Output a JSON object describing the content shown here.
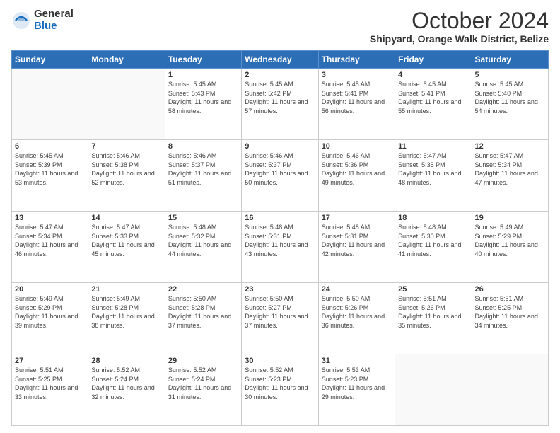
{
  "logo": {
    "general": "General",
    "blue": "Blue"
  },
  "title": "October 2024",
  "location": "Shipyard, Orange Walk District, Belize",
  "days_header": [
    "Sunday",
    "Monday",
    "Tuesday",
    "Wednesday",
    "Thursday",
    "Friday",
    "Saturday"
  ],
  "weeks": [
    [
      {
        "day": "",
        "sunrise": "",
        "sunset": "",
        "daylight": ""
      },
      {
        "day": "",
        "sunrise": "",
        "sunset": "",
        "daylight": ""
      },
      {
        "day": "1",
        "sunrise": "Sunrise: 5:45 AM",
        "sunset": "Sunset: 5:43 PM",
        "daylight": "Daylight: 11 hours and 58 minutes."
      },
      {
        "day": "2",
        "sunrise": "Sunrise: 5:45 AM",
        "sunset": "Sunset: 5:42 PM",
        "daylight": "Daylight: 11 hours and 57 minutes."
      },
      {
        "day": "3",
        "sunrise": "Sunrise: 5:45 AM",
        "sunset": "Sunset: 5:41 PM",
        "daylight": "Daylight: 11 hours and 56 minutes."
      },
      {
        "day": "4",
        "sunrise": "Sunrise: 5:45 AM",
        "sunset": "Sunset: 5:41 PM",
        "daylight": "Daylight: 11 hours and 55 minutes."
      },
      {
        "day": "5",
        "sunrise": "Sunrise: 5:45 AM",
        "sunset": "Sunset: 5:40 PM",
        "daylight": "Daylight: 11 hours and 54 minutes."
      }
    ],
    [
      {
        "day": "6",
        "sunrise": "Sunrise: 5:45 AM",
        "sunset": "Sunset: 5:39 PM",
        "daylight": "Daylight: 11 hours and 53 minutes."
      },
      {
        "day": "7",
        "sunrise": "Sunrise: 5:46 AM",
        "sunset": "Sunset: 5:38 PM",
        "daylight": "Daylight: 11 hours and 52 minutes."
      },
      {
        "day": "8",
        "sunrise": "Sunrise: 5:46 AM",
        "sunset": "Sunset: 5:37 PM",
        "daylight": "Daylight: 11 hours and 51 minutes."
      },
      {
        "day": "9",
        "sunrise": "Sunrise: 5:46 AM",
        "sunset": "Sunset: 5:37 PM",
        "daylight": "Daylight: 11 hours and 50 minutes."
      },
      {
        "day": "10",
        "sunrise": "Sunrise: 5:46 AM",
        "sunset": "Sunset: 5:36 PM",
        "daylight": "Daylight: 11 hours and 49 minutes."
      },
      {
        "day": "11",
        "sunrise": "Sunrise: 5:47 AM",
        "sunset": "Sunset: 5:35 PM",
        "daylight": "Daylight: 11 hours and 48 minutes."
      },
      {
        "day": "12",
        "sunrise": "Sunrise: 5:47 AM",
        "sunset": "Sunset: 5:34 PM",
        "daylight": "Daylight: 11 hours and 47 minutes."
      }
    ],
    [
      {
        "day": "13",
        "sunrise": "Sunrise: 5:47 AM",
        "sunset": "Sunset: 5:34 PM",
        "daylight": "Daylight: 11 hours and 46 minutes."
      },
      {
        "day": "14",
        "sunrise": "Sunrise: 5:47 AM",
        "sunset": "Sunset: 5:33 PM",
        "daylight": "Daylight: 11 hours and 45 minutes."
      },
      {
        "day": "15",
        "sunrise": "Sunrise: 5:48 AM",
        "sunset": "Sunset: 5:32 PM",
        "daylight": "Daylight: 11 hours and 44 minutes."
      },
      {
        "day": "16",
        "sunrise": "Sunrise: 5:48 AM",
        "sunset": "Sunset: 5:31 PM",
        "daylight": "Daylight: 11 hours and 43 minutes."
      },
      {
        "day": "17",
        "sunrise": "Sunrise: 5:48 AM",
        "sunset": "Sunset: 5:31 PM",
        "daylight": "Daylight: 11 hours and 42 minutes."
      },
      {
        "day": "18",
        "sunrise": "Sunrise: 5:48 AM",
        "sunset": "Sunset: 5:30 PM",
        "daylight": "Daylight: 11 hours and 41 minutes."
      },
      {
        "day": "19",
        "sunrise": "Sunrise: 5:49 AM",
        "sunset": "Sunset: 5:29 PM",
        "daylight": "Daylight: 11 hours and 40 minutes."
      }
    ],
    [
      {
        "day": "20",
        "sunrise": "Sunrise: 5:49 AM",
        "sunset": "Sunset: 5:29 PM",
        "daylight": "Daylight: 11 hours and 39 minutes."
      },
      {
        "day": "21",
        "sunrise": "Sunrise: 5:49 AM",
        "sunset": "Sunset: 5:28 PM",
        "daylight": "Daylight: 11 hours and 38 minutes."
      },
      {
        "day": "22",
        "sunrise": "Sunrise: 5:50 AM",
        "sunset": "Sunset: 5:28 PM",
        "daylight": "Daylight: 11 hours and 37 minutes."
      },
      {
        "day": "23",
        "sunrise": "Sunrise: 5:50 AM",
        "sunset": "Sunset: 5:27 PM",
        "daylight": "Daylight: 11 hours and 37 minutes."
      },
      {
        "day": "24",
        "sunrise": "Sunrise: 5:50 AM",
        "sunset": "Sunset: 5:26 PM",
        "daylight": "Daylight: 11 hours and 36 minutes."
      },
      {
        "day": "25",
        "sunrise": "Sunrise: 5:51 AM",
        "sunset": "Sunset: 5:26 PM",
        "daylight": "Daylight: 11 hours and 35 minutes."
      },
      {
        "day": "26",
        "sunrise": "Sunrise: 5:51 AM",
        "sunset": "Sunset: 5:25 PM",
        "daylight": "Daylight: 11 hours and 34 minutes."
      }
    ],
    [
      {
        "day": "27",
        "sunrise": "Sunrise: 5:51 AM",
        "sunset": "Sunset: 5:25 PM",
        "daylight": "Daylight: 11 hours and 33 minutes."
      },
      {
        "day": "28",
        "sunrise": "Sunrise: 5:52 AM",
        "sunset": "Sunset: 5:24 PM",
        "daylight": "Daylight: 11 hours and 32 minutes."
      },
      {
        "day": "29",
        "sunrise": "Sunrise: 5:52 AM",
        "sunset": "Sunset: 5:24 PM",
        "daylight": "Daylight: 11 hours and 31 minutes."
      },
      {
        "day": "30",
        "sunrise": "Sunrise: 5:52 AM",
        "sunset": "Sunset: 5:23 PM",
        "daylight": "Daylight: 11 hours and 30 minutes."
      },
      {
        "day": "31",
        "sunrise": "Sunrise: 5:53 AM",
        "sunset": "Sunset: 5:23 PM",
        "daylight": "Daylight: 11 hours and 29 minutes."
      },
      {
        "day": "",
        "sunrise": "",
        "sunset": "",
        "daylight": ""
      },
      {
        "day": "",
        "sunrise": "",
        "sunset": "",
        "daylight": ""
      }
    ]
  ]
}
